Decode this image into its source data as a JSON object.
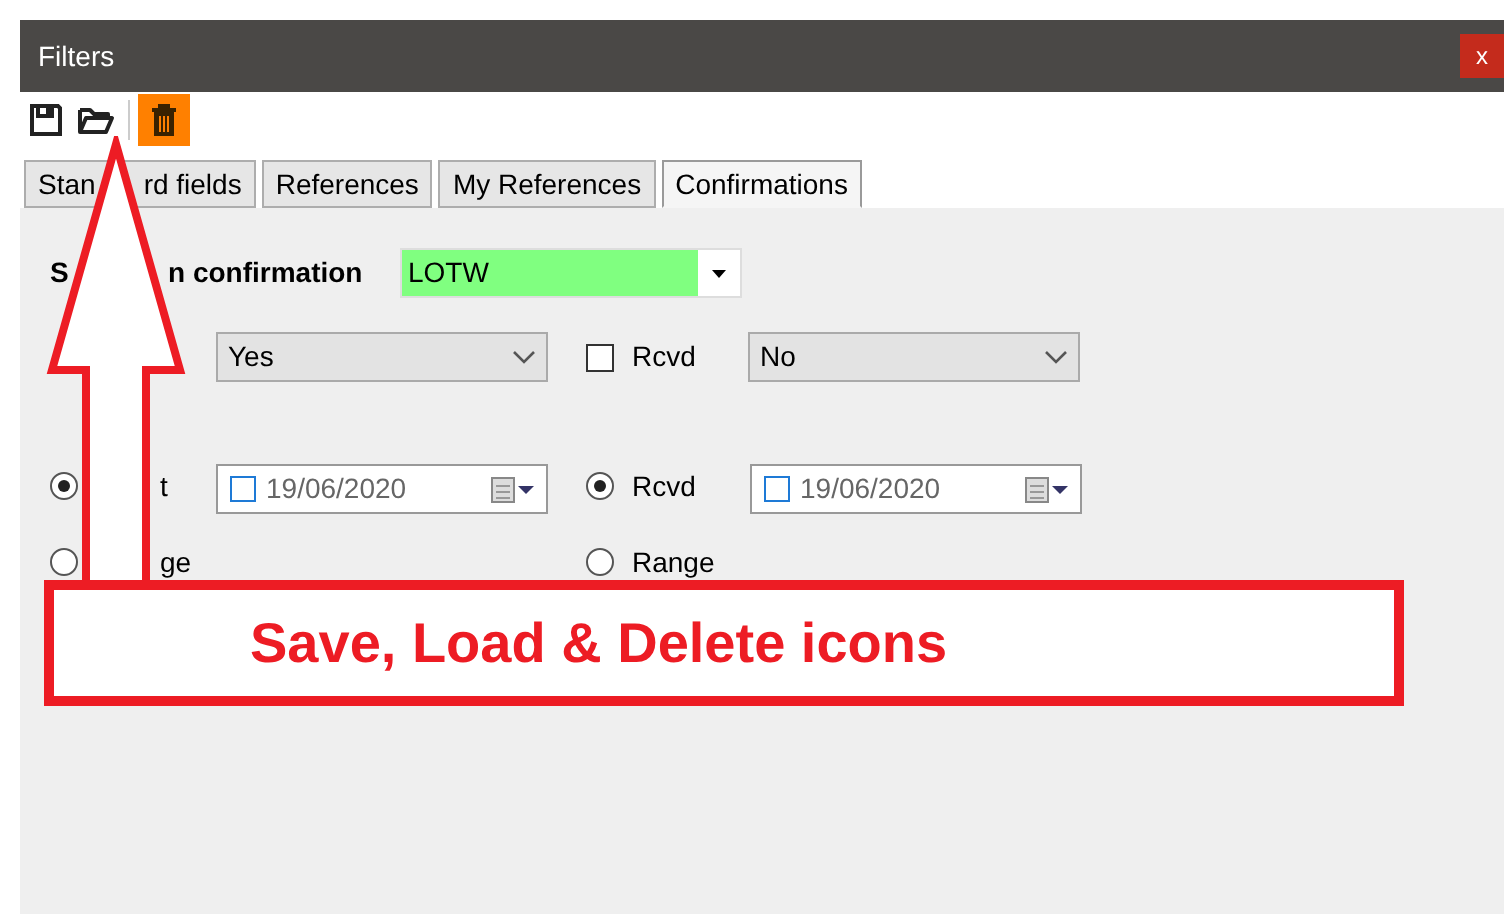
{
  "window": {
    "title": "Filters",
    "close": "x"
  },
  "toolbar": [
    {
      "kind": "save",
      "selected": false
    },
    {
      "kind": "load",
      "selected": false
    },
    {
      "kind": "delete",
      "selected": true
    }
  ],
  "tabs": [
    {
      "label_parts": [
        "Stan",
        "rd fields"
      ],
      "selected": false
    },
    {
      "label_parts": [
        "References"
      ],
      "selected": false
    },
    {
      "label_parts": [
        "My References"
      ],
      "selected": false
    },
    {
      "label_parts": [
        "Confirmations"
      ],
      "selected": true
    }
  ],
  "form": {
    "confirmation_label_parts": [
      "S",
      "n confirmation"
    ],
    "confirmation_value": "LOTW",
    "sent_select": "Yes",
    "rcvd_checkbox": {
      "label": "Rcvd",
      "checked": false
    },
    "rcvd_select": "No",
    "sent_mode": [
      {
        "label": "t",
        "selected": true
      },
      {
        "label": "ge",
        "selected": false
      }
    ],
    "sent_date": {
      "value": "19/06/2020",
      "checked": false
    },
    "rcvd_mode": [
      {
        "label": "Rcvd",
        "selected": true
      },
      {
        "label": "Range",
        "selected": false
      }
    ],
    "rcvd_date": {
      "value": "19/06/2020",
      "checked": false
    }
  },
  "callout": {
    "text": "Save, Load & Delete icons"
  }
}
